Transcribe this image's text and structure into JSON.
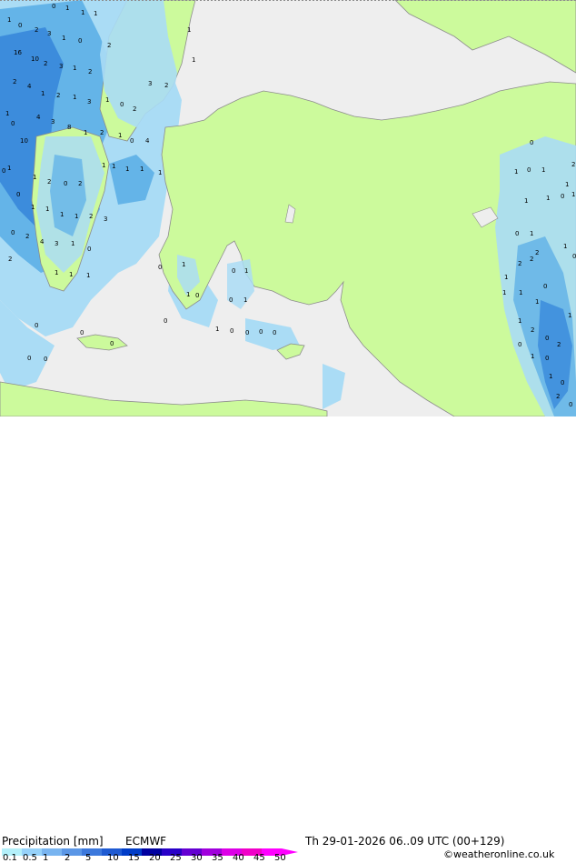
{
  "map": {
    "colors": {
      "sea": "#eeeeee",
      "land": "#ccfa9c",
      "precip_light": "#aadcf5",
      "precip_mid": "#64b4e8",
      "precip_heavy": "#3c8cdc"
    },
    "value_labels": [
      "0",
      "1",
      "1",
      "1",
      "1",
      "0",
      "2",
      "3",
      "1",
      "0",
      "2",
      "16",
      "10",
      "2",
      "3",
      "1",
      "2",
      "2",
      "4",
      "1",
      "2",
      "1",
      "3",
      "1",
      "0",
      "2",
      "3",
      "2",
      "1",
      "0",
      "10",
      "4",
      "3",
      "8",
      "1",
      "2",
      "1",
      "0",
      "4",
      "1",
      "1",
      "2",
      "0",
      "2",
      "1",
      "1",
      "1",
      "1",
      "1",
      "1",
      "1",
      "0",
      "0",
      "1",
      "1",
      "1",
      "1",
      "2",
      "3",
      "0",
      "2",
      "4",
      "3",
      "1",
      "0",
      "2",
      "1",
      "1",
      "1",
      "1",
      "0",
      "1",
      "1",
      "0",
      "0",
      "1",
      "1",
      "2",
      "2",
      "0",
      "1",
      "1",
      "1",
      "1",
      "2",
      "0",
      "0",
      "1",
      "0",
      "2",
      "1",
      "0",
      "2",
      "0",
      "0",
      "1",
      "1",
      "1",
      "0",
      "0",
      "1",
      "2",
      "1",
      "0",
      "1",
      "1",
      "0",
      "2",
      "1",
      "1",
      "0",
      "0",
      "1",
      "0",
      "0",
      "0",
      "0",
      "0",
      "0",
      "0",
      "0",
      "0"
    ]
  },
  "footer": {
    "title": "Precipitation [mm]",
    "model": "ECMWF",
    "datetime": "Th 29-01-2026 06..09 UTC (00+129)",
    "credit": "©weatheronline.co.uk",
    "scale": {
      "labels": [
        "0.1",
        "0.5",
        "1",
        "2",
        "5",
        "10",
        "15",
        "20",
        "25",
        "30",
        "35",
        "40",
        "45",
        "50"
      ],
      "colors": [
        "#b4f0fa",
        "#96d2fa",
        "#78b4f0",
        "#5a96e6",
        "#3c78dc",
        "#1e5ad2",
        "#003cc8",
        "#0000a0",
        "#2800c8",
        "#6400d2",
        "#a000dc",
        "#dc00e6",
        "#f000c8",
        "#ff00ff"
      ]
    }
  }
}
